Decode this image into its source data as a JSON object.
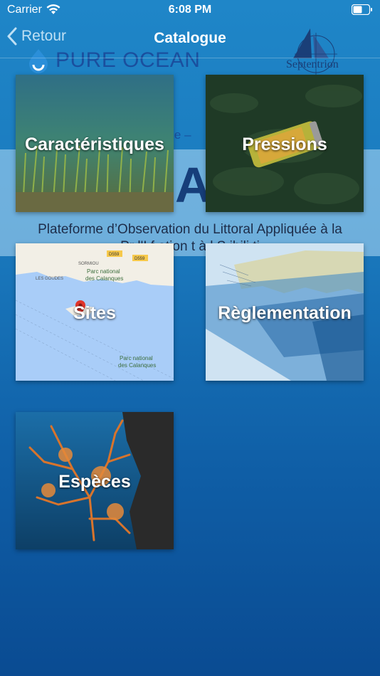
{
  "status_bar": {
    "carrier": "Carrier",
    "time": "6:08 PM",
    "wifi_icon": "wifi-icon",
    "battery_icon": "battery-icon"
  },
  "nav": {
    "back_label": "Retour",
    "back_icon": "chevron-left-icon",
    "title": "Catalogue"
  },
  "background_banner": {
    "logo_left": "PURE OCEAN",
    "logo_right": "Septentrion",
    "fragment": "nne –",
    "big_letter": "A",
    "subtitle_line1": "Plateforme d’Observation du Littoral Appliquée à la",
    "subtitle_line2": "Pr         l'I f         ation      t à l  S       ibili  ti"
  },
  "tiles": [
    {
      "label": "Caractéristiques",
      "image": "seagrass-underwater-photo"
    },
    {
      "label": "Pressions",
      "image": "can-debris-seabed-photo"
    },
    {
      "label": "Sites",
      "image": "map-calanques",
      "map_labels": [
        "D559",
        "D559",
        "SORMIOU",
        "Parc national",
        "des Calanques",
        "LES GOUDES",
        "Parc national",
        "des Calanques"
      ],
      "pin_icon": "map-pin-icon"
    },
    {
      "label": "Règlementation",
      "image": "regulation-zones-map"
    },
    {
      "label": "Espèces",
      "image": "gorgonian-coral-photo"
    }
  ],
  "colors": {
    "background_top": "#1f86c8",
    "background_bottom": "#0a4b92",
    "nav_back": "#bfe0f4",
    "map_land": "#f2efe6",
    "map_water": "#a9cdf8",
    "pin": "#e0352b"
  }
}
